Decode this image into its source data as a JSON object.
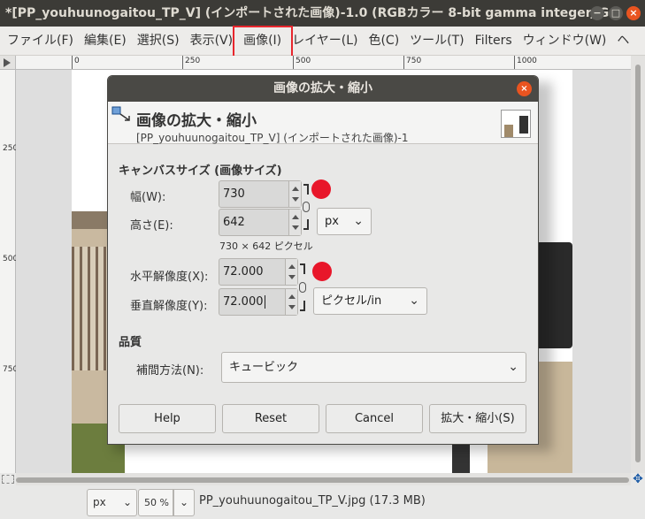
{
  "window": {
    "title": "*[PP_youhuunogaitou_TP_V] (インポートされた画像)-1.0 (RGBカラー 8-bit gamma integer, G...",
    "min_label": "−",
    "max_label": "□",
    "close_label": "×"
  },
  "menu": [
    "ファイル(F)",
    "編集(E)",
    "選択(S)",
    "表示(V)",
    "画像(I)",
    "レイヤー(L)",
    "色(C)",
    "ツール(T)",
    "Filters",
    "ウィンドウ(W)",
    "ヘ"
  ],
  "ruler": {
    "top_labels": [
      "0",
      "250",
      "500",
      "750",
      "1000"
    ],
    "left_labels": [
      "250",
      "500",
      "750"
    ]
  },
  "dialog": {
    "title": "画像の拡大・縮小",
    "close_label": "×",
    "header_title": "画像の拡大・縮小",
    "header_subtitle": "[PP_youhuunogaitou_TP_V] (インポートされた画像)-1",
    "canvas_section": "キャンバスサイズ (画像サイズ)",
    "width_label": "幅(W):",
    "width_value": "730",
    "height_label": "高さ(E):",
    "height_value": "642",
    "size_unit": "px",
    "size_note": "730 × 642 ピクセル",
    "xres_label": "水平解像度(X):",
    "xres_value": "72.000",
    "yres_label": "垂直解像度(Y):",
    "yres_value": "72.000",
    "res_unit": "ピクセル/in",
    "quality_section": "品質",
    "interp_label": "補間方法(N):",
    "interp_value": "キュービック",
    "buttons": {
      "help": "Help",
      "reset": "Reset",
      "cancel": "Cancel",
      "scale": "拡大・縮小(S)"
    }
  },
  "statusbar": {
    "unit": "px",
    "zoom": "50 %",
    "file_info": "PP_youhuunogaitou_TP_V.jpg (17.3 MB)"
  },
  "colors": {
    "highlight": "#e8262d",
    "marker": "#e8162a",
    "close": "#e95420"
  }
}
